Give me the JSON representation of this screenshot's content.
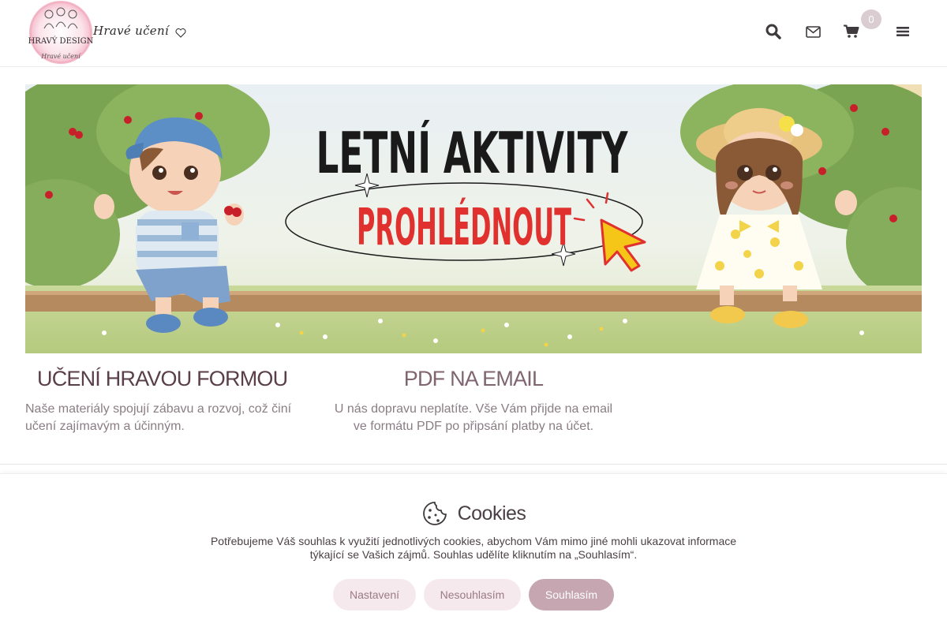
{
  "header": {
    "logo_text": "HRAVÝ DESIGN",
    "logo_subtext": "Hravé učení",
    "logo_script": "Hravé učení",
    "cart_count": "0",
    "icons": [
      "search-icon",
      "envelope-icon",
      "cart-icon",
      "hamburger-menu-icon"
    ]
  },
  "banner": {
    "title": "LETNÍ AKTIVITY",
    "cta": "PROHLÉDNOUT"
  },
  "features": [
    {
      "title": "UČENÍ HRAVOU FORMOU",
      "text": "Naše materiály spojují zábavu a rozvoj, což činí učení zajímavým a účinným."
    },
    {
      "title": "PDF NA EMAIL",
      "text": "U nás dopravu neplatíte. Vše Vám přijde na email ve formátu PDF po připsání platby na účet."
    }
  ],
  "cookies": {
    "title": "Cookies",
    "text": "Potřebujeme Váš souhlas k využití jednotlivých cookies, abychom Vám mimo jiné mohli ukazovat informace týkající se Vašich zájmů. Souhlas udělíte kliknutím na „Souhlasím“.",
    "buttons": {
      "settings": "Nastavení",
      "reject": "Nesouhlasím",
      "accept": "Souhlasím"
    }
  },
  "colors": {
    "accent": "#c6a6b1",
    "light_button": "#f6e9ee",
    "heading": "#5a3f4a",
    "muted_text": "#8a7d84",
    "badge": "#d9cdd1"
  }
}
